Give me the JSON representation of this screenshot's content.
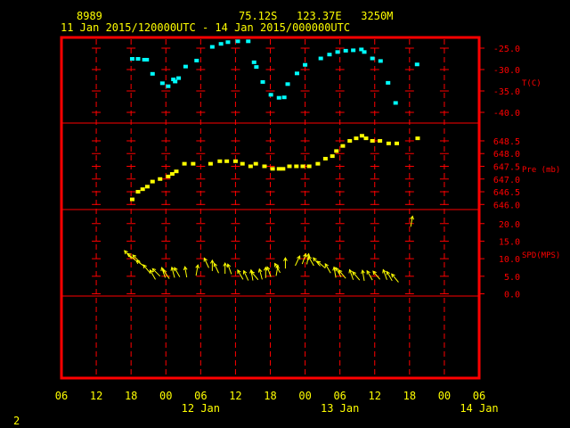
{
  "header": {
    "station_id": "8989",
    "location": "75.12S   123.37E   3250M",
    "time_range": "11 Jan 2015/120000UTC - 14 Jan 2015/000000UTC"
  },
  "footer": {
    "page_number": "2"
  },
  "colors": {
    "background": "#000000",
    "frame": "#ff0000",
    "text": "#ffff00",
    "axis_text": "#ff0000",
    "temperature": "#00ffff",
    "pressure": "#ffff00",
    "wind": "#ffff00"
  },
  "chart_data": [
    {
      "type": "scatter",
      "panel": "temperature",
      "ylabel": "T(C)",
      "ylim": [
        -40.0,
        -22.5
      ],
      "yticks": [
        -25.0,
        -30.0,
        -35.0,
        -40.0
      ],
      "ytick_labels": [
        "-25.0",
        "-30.0",
        "-35.0",
        "-40.0"
      ],
      "x": [
        12.2,
        13.2,
        14.3,
        14.7,
        15.7,
        17.4,
        18.4,
        19.3,
        19.6,
        20.2,
        21.4,
        23.3,
        26.0,
        27.5,
        28.7,
        30.4,
        32.2,
        33.2,
        33.6,
        34.7,
        36.1,
        37.5,
        38.4,
        39.0,
        40.6,
        42.0,
        44.7,
        46.2,
        47.6,
        49.0,
        50.3,
        51.7,
        52.2,
        53.6,
        55.0,
        56.3,
        57.6,
        61.3
      ],
      "y": [
        -27.5,
        -27.5,
        -27.7,
        -27.7,
        -31.0,
        -33.2,
        -33.9,
        -32.3,
        -32.8,
        -32.0,
        -29.3,
        -27.9,
        -24.7,
        -24.0,
        -23.6,
        -23.4,
        -23.4,
        -28.3,
        -29.4,
        -32.9,
        -35.9,
        -36.6,
        -36.5,
        -33.4,
        -30.9,
        -28.9,
        -27.4,
        -26.5,
        -25.9,
        -25.6,
        -25.5,
        -25.3,
        -25.9,
        -27.4,
        -28.0,
        -33.1,
        -37.8,
        -28.8
      ]
    },
    {
      "type": "scatter",
      "panel": "pressure",
      "ylabel": "Pre (mb)",
      "ylim": [
        646.0,
        649.0
      ],
      "yticks": [
        646.0,
        646.5,
        647.0,
        647.5,
        648.0,
        648.5
      ],
      "ytick_labels": [
        "646.0",
        "646.5",
        "647.0",
        "647.5",
        "648.0",
        "648.5"
      ],
      "x": [
        12.2,
        13.2,
        14.0,
        14.8,
        15.7,
        17.0,
        18.4,
        19.1,
        19.8,
        21.2,
        22.7,
        25.7,
        27.3,
        28.5,
        30.0,
        31.2,
        32.6,
        33.5,
        35.0,
        36.4,
        37.5,
        38.2,
        39.3,
        40.5,
        41.6,
        42.7,
        44.2,
        45.5,
        46.7,
        47.4,
        48.5,
        49.7,
        50.8,
        51.8,
        52.5,
        53.6,
        54.9,
        56.4,
        57.8,
        61.4
      ],
      "y": [
        646.2,
        646.5,
        646.6,
        646.7,
        646.9,
        647.0,
        647.1,
        647.2,
        647.3,
        647.6,
        647.6,
        647.6,
        647.7,
        647.7,
        647.7,
        647.6,
        647.5,
        647.6,
        647.5,
        647.4,
        647.4,
        647.4,
        647.5,
        647.5,
        647.5,
        647.5,
        647.6,
        647.8,
        647.9,
        648.1,
        648.3,
        648.5,
        648.6,
        648.7,
        648.6,
        648.5,
        648.5,
        648.4,
        648.4,
        648.6
      ]
    },
    {
      "type": "vector",
      "panel": "wind",
      "ylabel": "SPD(MPS)",
      "ylim": [
        -1.0,
        24.0
      ],
      "yticks": [
        0.0,
        5.0,
        10.0,
        15.0,
        20.0
      ],
      "ytick_labels": [
        "0.0",
        "5.0",
        "10.0",
        "15.0",
        "20.0"
      ],
      "direction_note": "arrow angle: degrees clockwise from up",
      "x": [
        12.1,
        12.8,
        13.6,
        14.4,
        15.3,
        16.2,
        17.0,
        17.9,
        18.6,
        19.5,
        20.4,
        21.6,
        23.2,
        25.4,
        26.0,
        27.1,
        28.2,
        29.3,
        31.3,
        32.2,
        33.0,
        33.9,
        34.6,
        35.2,
        36.1,
        37.0,
        37.7,
        38.6,
        40.3,
        41.5,
        42.3,
        43.5,
        44.6,
        45.5,
        46.4,
        47.3,
        48.2,
        49.0,
        50.3,
        51.4,
        52.2,
        53.6,
        54.9,
        56.1,
        57.0,
        58.1,
        60.2
      ],
      "y": [
        10.0,
        9.5,
        8.9,
        7.7,
        5.9,
        4.1,
        5.0,
        4.6,
        4.3,
        4.6,
        4.8,
        4.7,
        5.2,
        7.4,
        6.5,
        5.9,
        5.7,
        5.6,
        4.1,
        3.8,
        3.8,
        4.0,
        4.1,
        4.5,
        4.8,
        5.1,
        6.0,
        7.2,
        8.0,
        8.5,
        8.4,
        8.0,
        7.9,
        7.3,
        5.9,
        4.6,
        4.8,
        4.4,
        4.0,
        3.9,
        3.7,
        3.9,
        4.1,
        4.0,
        3.7,
        3.3,
        19.1
      ],
      "angle": [
        -42,
        -50,
        -45,
        -55,
        -40,
        -30,
        -45,
        -20,
        -35,
        -15,
        -30,
        -10,
        10,
        -25,
        0,
        -25,
        0,
        -20,
        -30,
        -25,
        -10,
        -40,
        -15,
        0,
        -20,
        10,
        -30,
        0,
        25,
        20,
        10,
        -30,
        -40,
        -50,
        -30,
        -10,
        -30,
        -40,
        -20,
        -40,
        -10,
        -30,
        -40,
        -20,
        -30,
        -40,
        10
      ]
    }
  ],
  "x_axis": {
    "xlim": [
      0,
      72
    ],
    "ticks": [
      0,
      6,
      12,
      18,
      24,
      30,
      36,
      42,
      48,
      54,
      60,
      66,
      72
    ],
    "tick_labels": [
      "06",
      "12",
      "18",
      "00",
      "06",
      "12",
      "18",
      "00",
      "06",
      "12",
      "18",
      "00",
      "06"
    ],
    "date_labels": [
      {
        "x": 24,
        "text": "12 Jan"
      },
      {
        "x": 48,
        "text": "13 Jan"
      },
      {
        "x": 72,
        "text": "14 Jan"
      }
    ]
  }
}
